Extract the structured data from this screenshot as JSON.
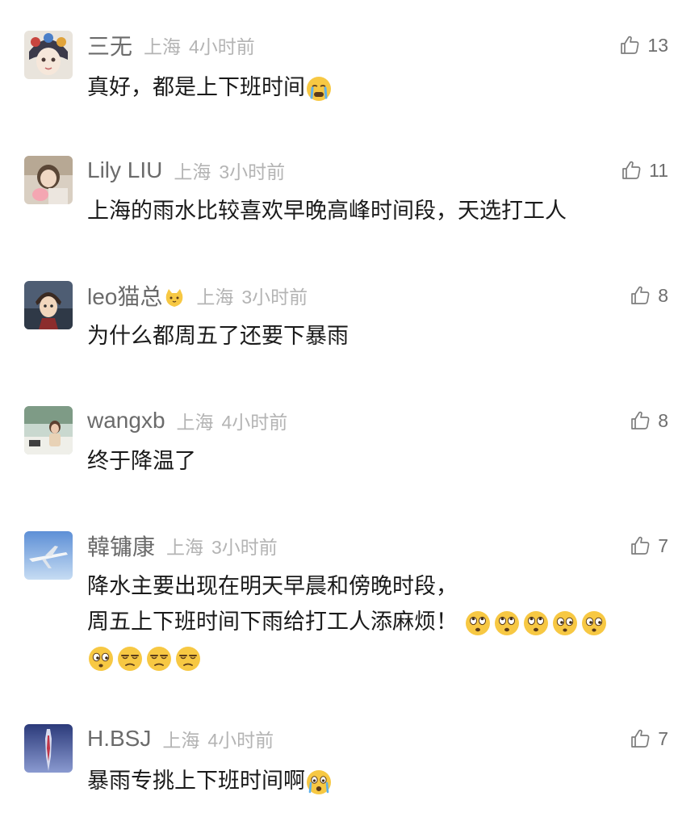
{
  "comments": [
    {
      "user": "三无",
      "location": "上海",
      "time": "4小时前",
      "likes": "13",
      "lines": [
        "真好，都是上下班时间"
      ],
      "trailing_emoji": "crying-face-icon"
    },
    {
      "user": "Lily LIU",
      "location": "上海",
      "time": "3小时前",
      "likes": "11",
      "lines": [
        "上海的雨水比较喜欢早晚高峰时间段，天选打工人"
      ]
    },
    {
      "user": "leo猫总",
      "user_emoji": "cat-face-icon",
      "location": "上海",
      "time": "3小时前",
      "likes": "8",
      "lines": [
        "为什么都周五了还要下暴雨"
      ]
    },
    {
      "user": "wangxb",
      "location": "上海",
      "time": "4小时前",
      "likes": "8",
      "lines": [
        "终于降温了"
      ]
    },
    {
      "user": "韓镛康",
      "location": "上海",
      "time": "3小时前",
      "likes": "7",
      "lines": [
        "降水主要出现在明天早晨和傍晚时段，",
        "周五上下班时间下雨给打工人添麻烦！"
      ],
      "emoji_sequence": [
        "rolling-eyes-face-icon",
        "rolling-eyes-face-icon",
        "rolling-eyes-face-icon",
        "eye-roll-face-icon",
        "eye-roll-face-icon",
        "eye-roll-face-icon",
        "unamused-face-icon",
        "unamused-face-icon",
        "unamused-face-icon"
      ]
    },
    {
      "user": "H.BSJ",
      "location": "上海",
      "time": "4小时前",
      "likes": "7",
      "lines": [
        "暴雨专挑上下班时间啊"
      ],
      "trailing_emoji": "distressed-face-icon"
    }
  ],
  "colors": {
    "username": "#6b6b6b",
    "meta": "#b4b4b4",
    "body_text": "#1a1a1a",
    "like_icon": "#8a8a8a",
    "emoji_yellow": "#f7c843"
  }
}
